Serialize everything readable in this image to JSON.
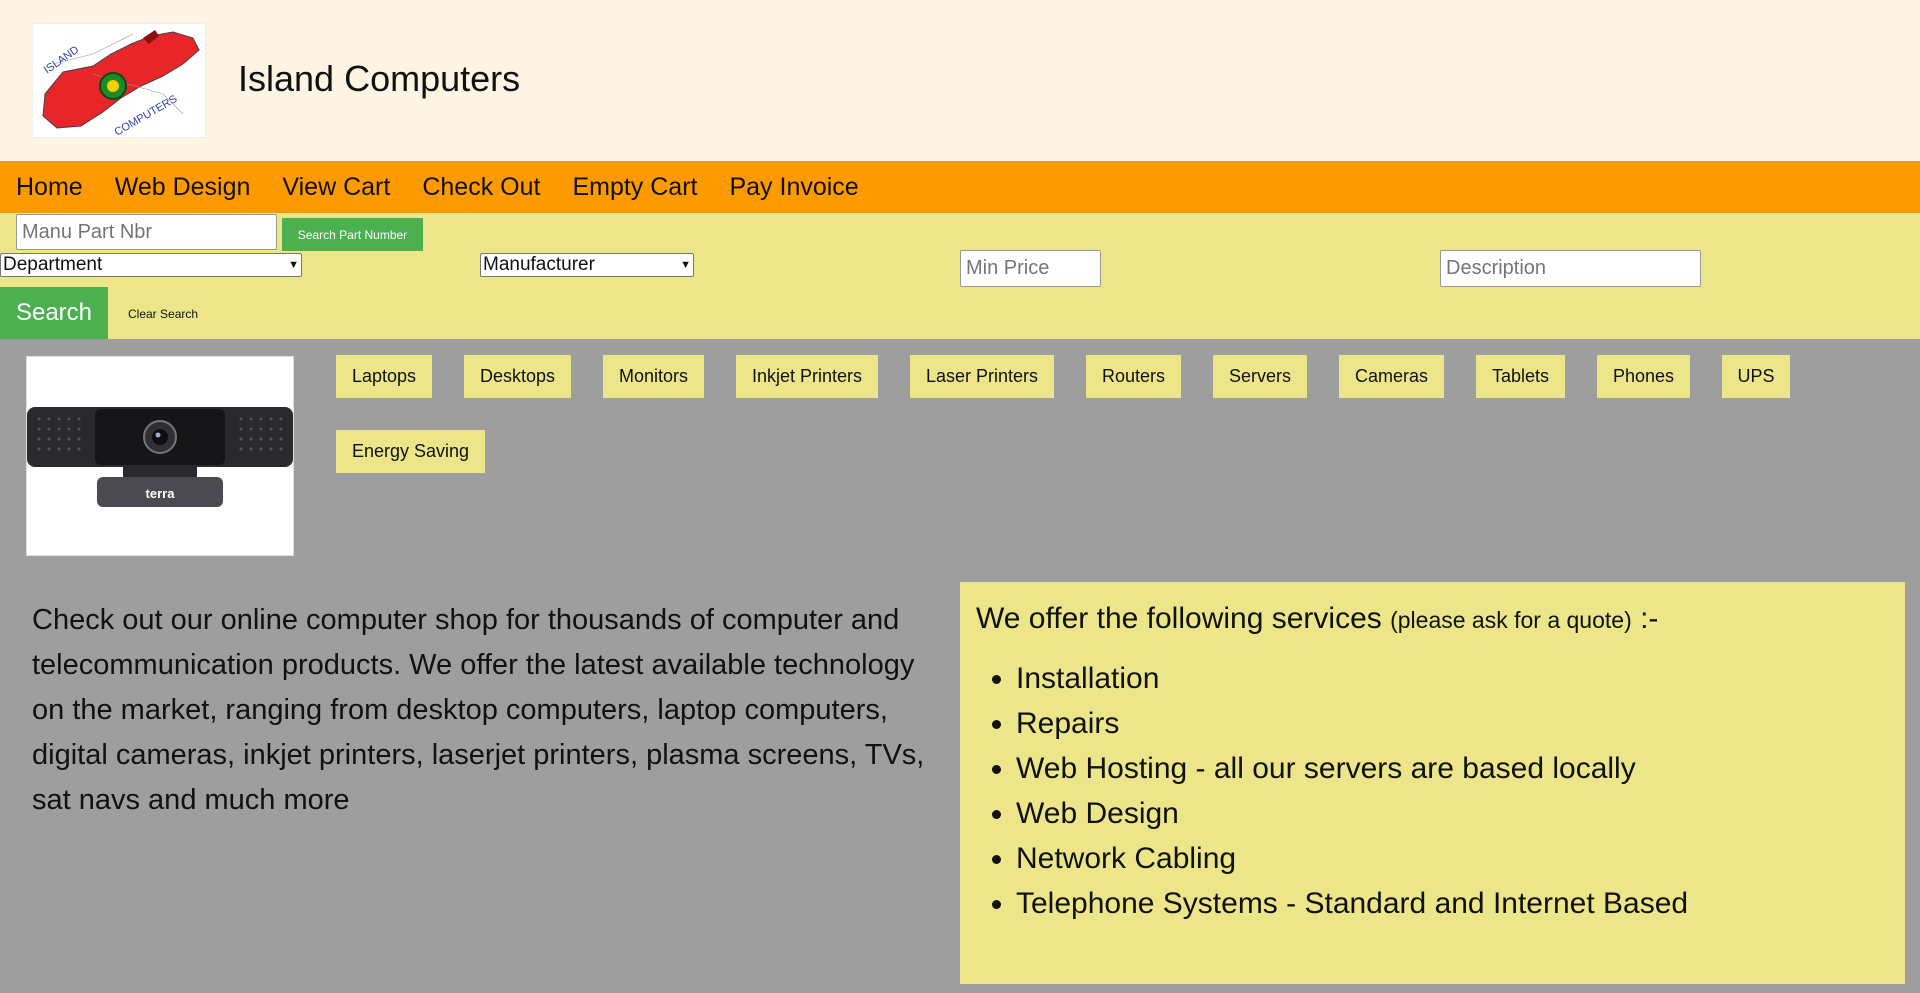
{
  "header": {
    "logo": {
      "alt": "Island Computers logo",
      "icon": "jersey-map-logo",
      "text_top": "ISLAND",
      "text_bottom": "COMPUTERS"
    },
    "title": "Island Computers"
  },
  "nav": {
    "items": [
      "Home",
      "Web Design",
      "View Cart",
      "Check Out",
      "Empty Cart",
      "Pay Invoice"
    ]
  },
  "search": {
    "part_placeholder": "Manu Part Nbr",
    "part_button": "Search Part Number",
    "department_selected": "Department",
    "manufacturer_selected": "Manufacturer",
    "min_price_placeholder": "Min Price",
    "description_placeholder": "Description",
    "search_button": "Search",
    "clear_link": "Clear Search"
  },
  "product_image": {
    "icon": "webcam-image",
    "brand": "terra"
  },
  "categories": [
    "Laptops",
    "Desktops",
    "Monitors",
    "Inkjet Printers",
    "Laser Printers",
    "Routers",
    "Servers",
    "Cameras",
    "Tablets",
    "Phones",
    "UPS",
    "Energy Saving"
  ],
  "intro": {
    "text": "Check out our online computer shop for thousands of computer and telecommunication products. We offer the latest available technology on the market, ranging from desktop computers, laptop computers, digital cameras, inkjet printers, laserjet printers, plasma screens, TVs, sat navs and much more"
  },
  "services": {
    "title_main": "We offer the following services",
    "title_note": "(please ask for a quote)",
    "title_suffix": ":-",
    "items": [
      "Installation",
      "Repairs",
      "Web Hosting - all our servers are based locally",
      "Web Design",
      "Network Cabling",
      "Telephone Systems - Standard and Internet Based"
    ]
  },
  "colors": {
    "header_bg": "#fdf4e3",
    "nav_bg": "#fc9a00",
    "search_bg": "#ede58a",
    "accent_green": "#4caf50",
    "page_bg": "#9e9e9e"
  }
}
